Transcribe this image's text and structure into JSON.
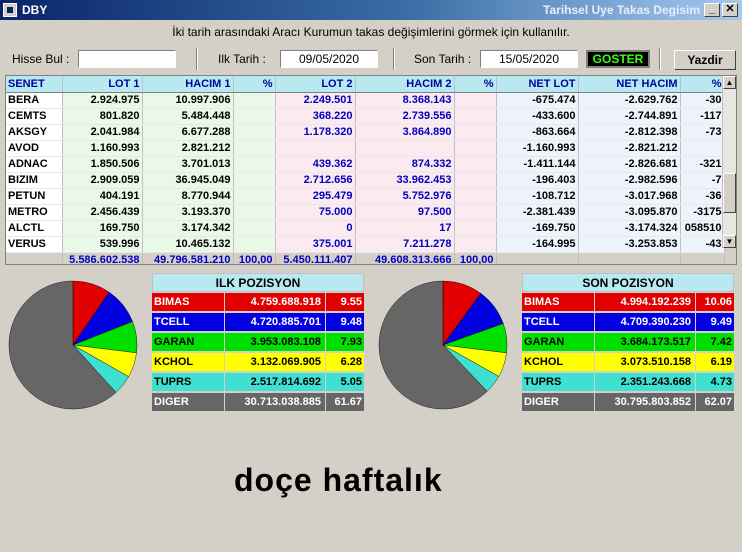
{
  "window": {
    "app_title": "DBY",
    "title": "Tarihsel Uye Takas Degisim"
  },
  "hint": "İki tarih arasındaki  Aracı Kurumun takas değişimlerini görmek için kullanılır.",
  "controls": {
    "hisse_label": "Hisse Bul :",
    "hisse_value": "",
    "ilk_label": "Ilk Tarih :",
    "ilk_value": "09/05/2020",
    "son_label": "Son Tarih :",
    "son_value": "15/05/2020",
    "goster": "GOSTER",
    "yazdir": "Yazdir"
  },
  "table": {
    "headers": [
      "SENET",
      "LOT 1",
      "HACIM 1",
      "%",
      "LOT 2",
      "HACIM 2",
      "%",
      "NET LOT",
      "NET HACIM",
      "%"
    ],
    "rows": [
      [
        "BERA",
        "2.924.975",
        "10.997.906",
        "",
        "2.249.501",
        "8.368.143",
        "",
        "-675.474",
        "-2.629.762",
        "-30"
      ],
      [
        "CEMTS",
        "801.820",
        "5.484.448",
        "",
        "368.220",
        "2.739.556",
        "",
        "-433.600",
        "-2.744.891",
        "-117"
      ],
      [
        "AKSGY",
        "2.041.984",
        "6.677.288",
        "",
        "1.178.320",
        "3.864.890",
        "",
        "-863.664",
        "-2.812.398",
        "-73"
      ],
      [
        "AVOD",
        "1.160.993",
        "2.821.212",
        "",
        "",
        "",
        "",
        "-1.160.993",
        "-2.821.212",
        ""
      ],
      [
        "ADNAC",
        "1.850.506",
        "3.701.013",
        "",
        "439.362",
        "874.332",
        "",
        "-1.411.144",
        "-2.826.681",
        "-321"
      ],
      [
        "BIZIM",
        "2.909.059",
        "36.945.049",
        "",
        "2.712.656",
        "33.962.453",
        "",
        "-196.403",
        "-2.982.596",
        "-7"
      ],
      [
        "PETUN",
        "404.191",
        "8.770.944",
        "",
        "295.479",
        "5.752.976",
        "",
        "-108.712",
        "-3.017.968",
        "-36"
      ],
      [
        "METRO",
        "2.456.439",
        "3.193.370",
        "",
        "75.000",
        "97.500",
        "",
        "-2.381.439",
        "-3.095.870",
        "-3175"
      ],
      [
        "ALCTL",
        "169.750",
        "3.174.342",
        "",
        "0",
        "17",
        "",
        "-169.750",
        "-3.174.324",
        "058510"
      ],
      [
        "VERUS",
        "539.996",
        "10.465.132",
        "",
        "375.001",
        "7.211.278",
        "",
        "-164.995",
        "-3.253.853",
        "-43"
      ]
    ],
    "totals": [
      "",
      "5.586.602.538",
      "49.796.581.210",
      "100,00",
      "5.450.111.407",
      "49.608.313.666",
      "100,00",
      "",
      "",
      ""
    ]
  },
  "ilk_pozisyon": {
    "title": "ILK POZISYON",
    "rows": [
      {
        "name": "BIMAS",
        "value": "4.759.688.918",
        "pct": "9.55",
        "color": "#e00000",
        "text": "#ffffff"
      },
      {
        "name": "TCELL",
        "value": "4.720.885.701",
        "pct": "9.48",
        "color": "#0000e0",
        "text": "#ffffff"
      },
      {
        "name": "GARAN",
        "value": "3.953.083.108",
        "pct": "7.93",
        "color": "#00e000",
        "text": "#000000"
      },
      {
        "name": "KCHOL",
        "value": "3.132.069.905",
        "pct": "6.28",
        "color": "#ffff00",
        "text": "#000000"
      },
      {
        "name": "TUPRS",
        "value": "2.517.814.692",
        "pct": "5.05",
        "color": "#40e0d0",
        "text": "#000000"
      },
      {
        "name": "DIGER",
        "value": "30.713.038.885",
        "pct": "61.67",
        "color": "#666666",
        "text": "#ffffff"
      }
    ]
  },
  "son_pozisyon": {
    "title": "SON POZISYON",
    "rows": [
      {
        "name": "BIMAS",
        "value": "4.994.192.239",
        "pct": "10.06",
        "color": "#e00000",
        "text": "#ffffff"
      },
      {
        "name": "TCELL",
        "value": "4.709.390.230",
        "pct": "9.49",
        "color": "#0000e0",
        "text": "#ffffff"
      },
      {
        "name": "GARAN",
        "value": "3.684.173.517",
        "pct": "7.42",
        "color": "#00e000",
        "text": "#000000"
      },
      {
        "name": "KCHOL",
        "value": "3.073.510.158",
        "pct": "6.19",
        "color": "#ffff00",
        "text": "#000000"
      },
      {
        "name": "TUPRS",
        "value": "2.351.243.668",
        "pct": "4.73",
        "color": "#40e0d0",
        "text": "#000000"
      },
      {
        "name": "DIGER",
        "value": "30.795.803.852",
        "pct": "62.07",
        "color": "#666666",
        "text": "#ffffff"
      }
    ]
  },
  "caption": "doçe haftalık"
}
